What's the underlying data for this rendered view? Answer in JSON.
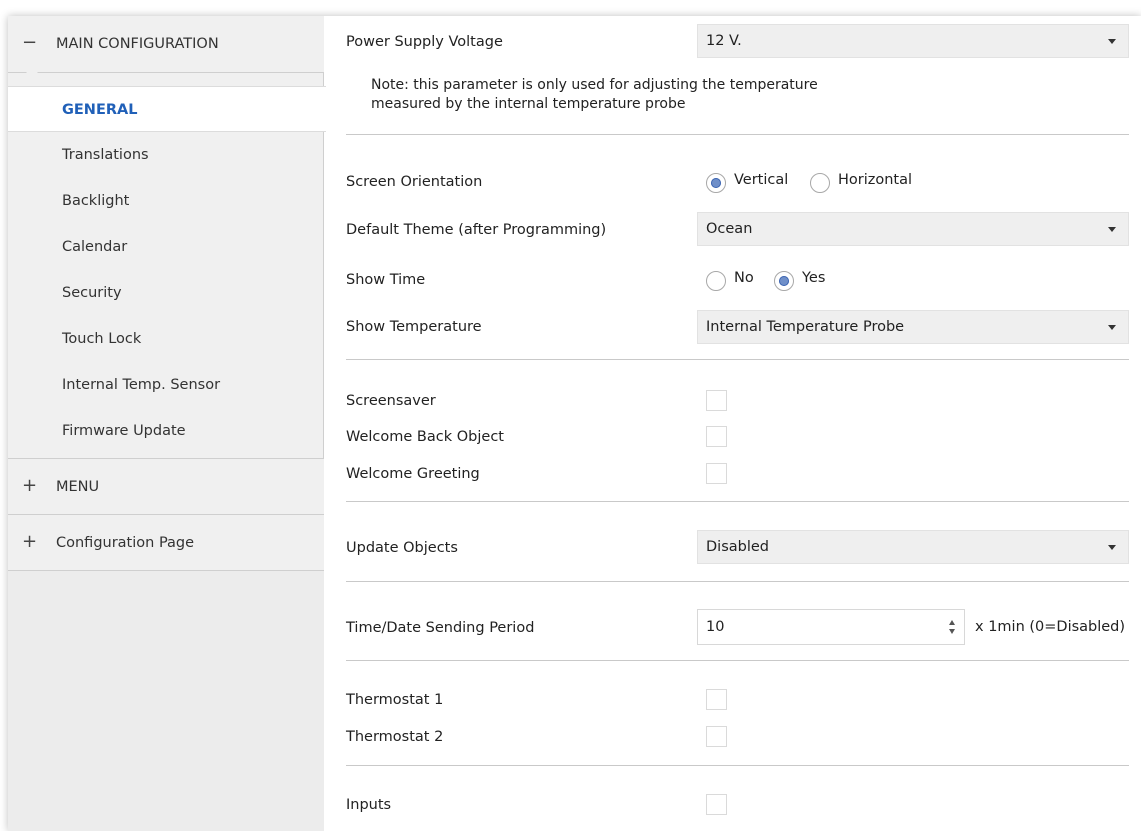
{
  "sidebar": {
    "main_group": {
      "sign": "−",
      "label": "MAIN CONFIGURATION"
    },
    "items": [
      {
        "label": "GENERAL",
        "active": true
      },
      {
        "label": "Translations"
      },
      {
        "label": "Backlight"
      },
      {
        "label": "Calendar"
      },
      {
        "label": "Security"
      },
      {
        "label": "Touch Lock"
      },
      {
        "label": "Internal Temp. Sensor"
      },
      {
        "label": "Firmware Update"
      }
    ],
    "menu_group": {
      "sign": "+",
      "label": "MENU"
    },
    "config_group": {
      "sign": "+",
      "label": "Configuration Page"
    }
  },
  "main": {
    "power_supply": {
      "label": "Power Supply Voltage",
      "value": "12 V."
    },
    "note": {
      "line1": "Note: this parameter is only used for adjusting the temperature",
      "line2": "measured by the internal temperature probe"
    },
    "screen_orientation": {
      "label": "Screen Orientation",
      "options": [
        "Vertical",
        "Horizontal"
      ],
      "selected": "Vertical"
    },
    "default_theme": {
      "label": "Default Theme (after Programming)",
      "value": "Ocean"
    },
    "show_time": {
      "label": "Show Time",
      "options": [
        "No",
        "Yes"
      ],
      "selected": "Yes"
    },
    "show_temperature": {
      "label": "Show Temperature",
      "value": "Internal Temperature Probe"
    },
    "screensaver": {
      "label": "Screensaver",
      "checked": false
    },
    "welcome_back_object": {
      "label": "Welcome Back Object",
      "checked": false
    },
    "welcome_greeting": {
      "label": "Welcome Greeting",
      "checked": false
    },
    "update_objects": {
      "label": "Update Objects",
      "value": "Disabled"
    },
    "time_date_sending_period": {
      "label": "Time/Date Sending Period",
      "value": "10",
      "unit": "x 1min (0=Disabled)"
    },
    "thermostat_1": {
      "label": "Thermostat 1",
      "checked": false
    },
    "thermostat_2": {
      "label": "Thermostat 2",
      "checked": false
    },
    "inputs": {
      "label": "Inputs",
      "checked": false
    }
  },
  "colors": {
    "accent": "#2060b8",
    "sidebar_bg": "#f0f0f0",
    "select_bg": "#efefef",
    "radio_dot": "#6f8fc9"
  },
  "icons": {
    "collapse": "minus-icon",
    "expand": "plus-icon",
    "dropdown": "chevron-down-icon",
    "spin_up": "spin-up-icon",
    "spin_down": "spin-down-icon"
  }
}
